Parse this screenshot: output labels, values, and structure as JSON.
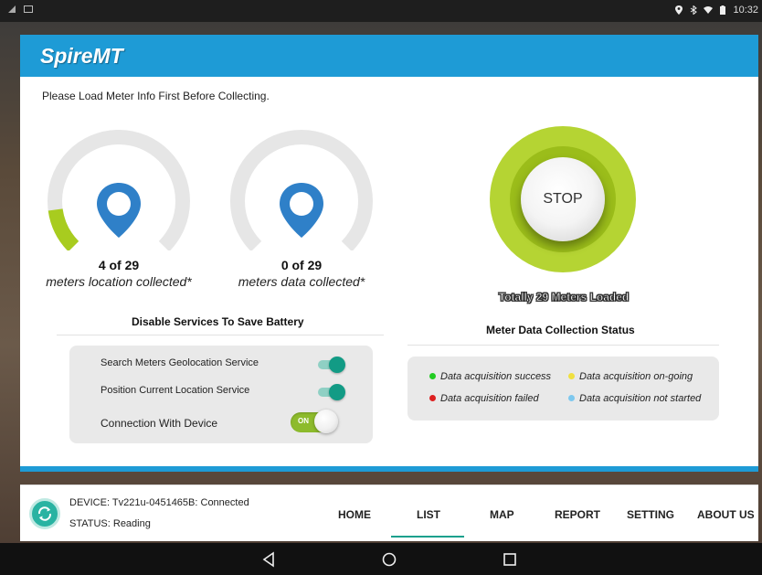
{
  "status_bar": {
    "time": "10:32",
    "left_icons": [
      "signal-icon",
      "image-icon"
    ],
    "right_icons": [
      "location-icon",
      "bluetooth-icon",
      "wifi-icon",
      "battery-icon"
    ]
  },
  "app": {
    "title": "SpireMT",
    "notice": "Please Load Meter Info First Before Collecting."
  },
  "gauges": [
    {
      "count": "4 of 29",
      "label": "meters location collected*",
      "progress": 0.138,
      "icon": "map-pin-icon"
    },
    {
      "count": "0 of 29",
      "label": "meters data collected*",
      "progress": 0.0,
      "icon": "map-pin-icon"
    }
  ],
  "battery_section": {
    "title": "Disable Services To Save Battery",
    "services": [
      {
        "label": "Search Meters Geolocation Service",
        "enabled": true
      },
      {
        "label": "Position Current Location Service",
        "enabled": true
      },
      {
        "label": "Connection With Device",
        "enabled": true,
        "toggle_text": "ON"
      }
    ]
  },
  "collection": {
    "stop_label": "STOP",
    "meters_loaded": "Totally 29 Meters Loaded",
    "status_title": "Meter Data Collection Status",
    "legend": [
      {
        "label": "Data acquisition success",
        "color": "#22cc22"
      },
      {
        "label": "Data acquisition on-going",
        "color": "#f0e040"
      },
      {
        "label": "Data acquisition failed",
        "color": "#dd2020"
      },
      {
        "label": "Data acquisition not started",
        "color": "#7ec8ee"
      }
    ]
  },
  "device": {
    "device_line": "DEVICE:  Tv221u-0451465B: Connected",
    "status_line": "STATUS: Reading"
  },
  "nav": {
    "items": [
      "HOME",
      "LIST",
      "MAP",
      "REPORT",
      "SETTING",
      "ABOUT US"
    ],
    "active": "LIST"
  },
  "colors": {
    "header_blue": "#1e9bd6",
    "progress_green": "#a8cc1f",
    "teal": "#129b85"
  }
}
